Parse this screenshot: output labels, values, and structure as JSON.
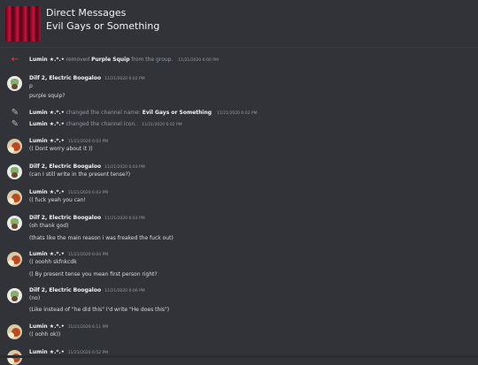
{
  "header": {
    "title": "Direct Messages",
    "group_name": "Evil Gays or Something",
    "icon": "red-curtain-image"
  },
  "system_events": [
    {
      "icon": "arrow-left-icon",
      "actor": "Lumin ★.*.•",
      "pre": "removed",
      "target": "Purple Squip",
      "post": "from the group.",
      "timestamp": "11/21/2020 6:00 PM"
    },
    {
      "icon": "pencil-icon",
      "actor": "Lumin ★.*.•",
      "pre": "changed the channel name:",
      "target": "Evil Gays or Something",
      "post": "",
      "timestamp": "11/21/2020 6:02 PM"
    },
    {
      "icon": "pencil-icon",
      "actor": "Lumin ★.*.•",
      "pre": "changed the channel icon.",
      "target": "",
      "post": "",
      "timestamp": "11/21/2020 6:02 PM"
    }
  ],
  "messages": [
    {
      "author": "Dilf 2, Electric Boogaloo",
      "timestamp": "11/21/2020 6:02 PM",
      "lines": [
        "p",
        "purple squip?"
      ]
    },
    {
      "author": "Lumin ★.*.•",
      "timestamp": "11/21/2020 6:03 PM",
      "lines": [
        "(( Dont worry about it ))"
      ]
    },
    {
      "author": "Dilf 2, Electric Boogaloo",
      "timestamp": "11/21/2020 6:03 PM",
      "lines": [
        "(can I still write in the present tense?)"
      ]
    },
    {
      "author": "Lumin ★.*.•",
      "timestamp": "11/21/2020 6:03 PM",
      "lines": [
        "(( fuck yeah you can!"
      ]
    },
    {
      "author": "Dilf 2, Electric Boogaloo",
      "timestamp": "11/21/2020 6:03 PM",
      "lines": [
        "(oh thank god)",
        "(thats like the main reason i was freaked the fuck out)"
      ]
    },
    {
      "author": "Lumin ★.*.•",
      "timestamp": "11/21/2020 6:04 PM",
      "lines": [
        "(( ooohh skfnkcdk",
        "(( By present tense you mean first person right?"
      ]
    },
    {
      "author": "Dilf 2, Electric Boogaloo",
      "timestamp": "11/21/2020 6:06 PM",
      "lines": [
        "(no)",
        "(Like instead of \"he did this\" I'd write \"He does this\")"
      ]
    },
    {
      "author": "Lumin ★.*.•",
      "timestamp": "11/21/2020 6:11 PM",
      "lines": [
        "(( oohh ok))"
      ]
    },
    {
      "author": "Lumin ★.*.•",
      "timestamp": "11/21/2020 6:52 PM",
      "lines": []
    }
  ]
}
